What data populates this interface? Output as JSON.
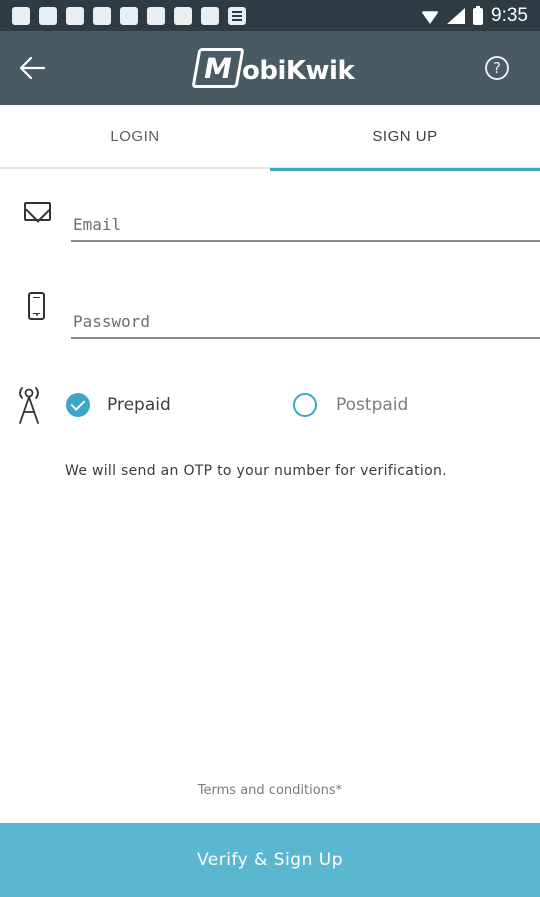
{
  "status_bar": {
    "time": "9:35",
    "notification_icons": [
      "app-icon",
      "app-icon",
      "app-icon",
      "app-icon",
      "app-icon",
      "app-icon",
      "app-icon",
      "app-icon",
      "more-icon"
    ]
  },
  "app_bar": {
    "logo_mark": "M",
    "logo_text": "obiKwik",
    "help_symbol": "?"
  },
  "tabs": {
    "login_label": "LOGIN",
    "signup_label": "SIGN UP"
  },
  "form": {
    "email_placeholder": "Email",
    "password_placeholder": "Password"
  },
  "connection_type": {
    "options": [
      {
        "label": "Prepaid",
        "selected": true
      },
      {
        "label": "Postpaid",
        "selected": false
      }
    ]
  },
  "otp_note": "We will send an OTP to your number for verification.",
  "terms_label": "Terms and conditions*",
  "verify_button_label": "Verify & Sign Up",
  "colors": {
    "accent": "#3aa6c8",
    "app_bar": "#4a5a63",
    "status_bar": "#2e3b43",
    "button": "#5ab7cf"
  }
}
